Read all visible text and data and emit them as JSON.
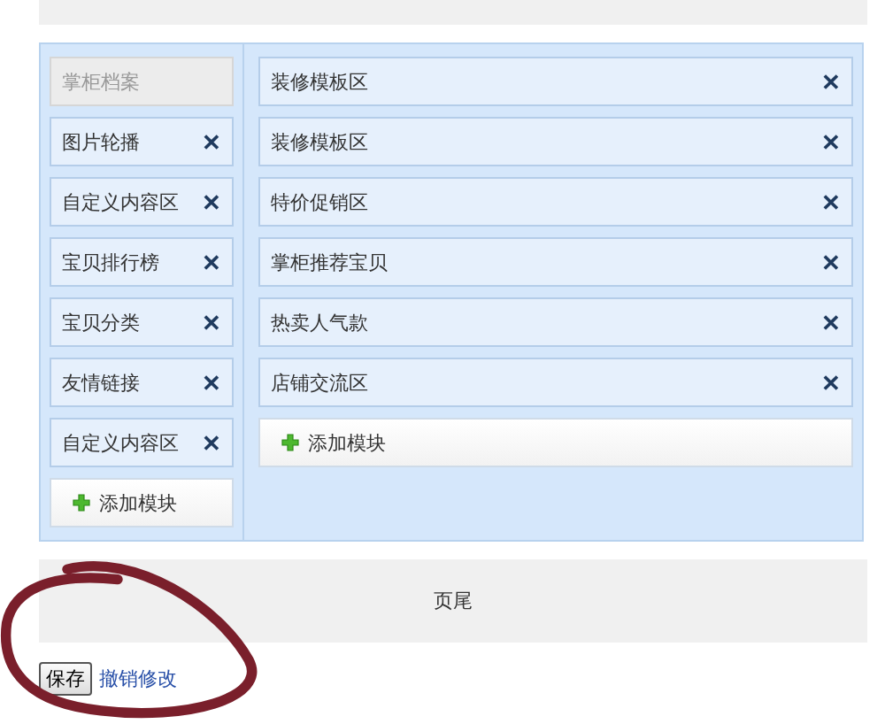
{
  "left_column": {
    "modules": [
      {
        "label": "掌柜档案",
        "removable": false
      },
      {
        "label": "图片轮播",
        "removable": true,
        "remove_icon": "✕"
      },
      {
        "label": "自定义内容区",
        "removable": true,
        "remove_icon": "✕"
      },
      {
        "label": "宝贝排行榜",
        "removable": true,
        "remove_icon": "✕"
      },
      {
        "label": "宝贝分类",
        "removable": true,
        "remove_icon": "✕"
      },
      {
        "label": "友情链接",
        "removable": true,
        "remove_icon": "✕"
      },
      {
        "label": "自定义内容区",
        "removable": true,
        "remove_icon": "✕"
      }
    ],
    "add_button": "添加模块"
  },
  "right_column": {
    "modules": [
      {
        "label": "装修模板区",
        "removable": true,
        "remove_icon": "✕"
      },
      {
        "label": "装修模板区",
        "removable": true,
        "remove_icon": "✕"
      },
      {
        "label": "特价促销区",
        "removable": true,
        "remove_icon": "✕"
      },
      {
        "label": "掌柜推荐宝贝",
        "removable": true,
        "remove_icon": "✕"
      },
      {
        "label": "热卖人气款",
        "removable": true,
        "remove_icon": "✕"
      },
      {
        "label": "店铺交流区",
        "removable": true,
        "remove_icon": "✕"
      }
    ],
    "add_button": "添加模块"
  },
  "footer": {
    "label": "页尾"
  },
  "actions": {
    "save_button": "保存",
    "cancel_link": "撤销修改"
  }
}
